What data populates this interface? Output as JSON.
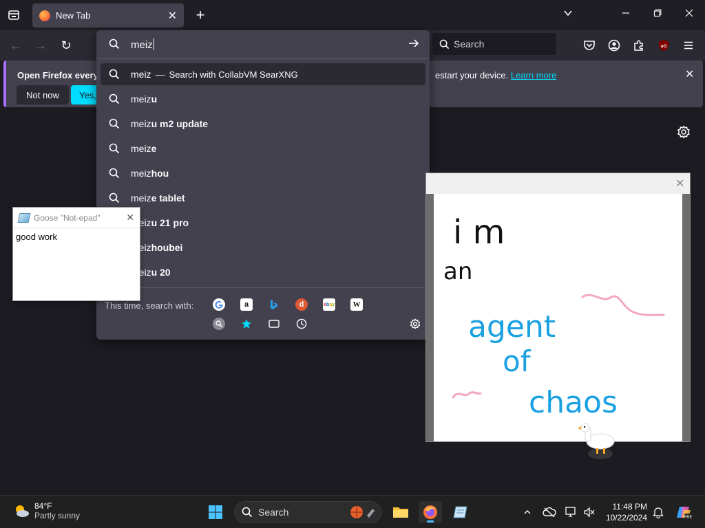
{
  "browser": {
    "tab": {
      "title": "New Tab",
      "close": "✕"
    },
    "new_tab": "+",
    "window_controls": {
      "list": "⌄",
      "minimize": "—",
      "maximize": "❐",
      "close": "✕"
    },
    "nav": {
      "back": "←",
      "forward": "→",
      "reload": "↻"
    },
    "search_placeholder": "Search"
  },
  "notification": {
    "message_start": "Open Firefox every ti",
    "message_end": "estart your device.",
    "learn_more": "Learn more",
    "not_now": "Not now",
    "yes": "Yes, o",
    "close": "✕"
  },
  "urlbar": {
    "value": "meiz",
    "suggestions": [
      {
        "typed": "meiz",
        "rest": "",
        "sep": "—",
        "action": "Search with CollabVM SearXNG",
        "selected": true
      },
      {
        "typed": "meiz",
        "rest": "u"
      },
      {
        "typed": "meiz",
        "rest": "u m2 update"
      },
      {
        "typed": "meiz",
        "rest": "e"
      },
      {
        "typed": "meiz",
        "rest": "hou"
      },
      {
        "typed": "meiz",
        "rest": "e tablet"
      },
      {
        "typed": "meiz",
        "rest": "u 21 pro"
      },
      {
        "typed": "meiz",
        "rest": "houbei"
      },
      {
        "typed": "meiz",
        "rest": "u 20"
      }
    ],
    "oneoff_label": "This time, search with:",
    "engines": [
      "google-icon",
      "amazon-icon",
      "bing-icon",
      "duckduckgo-icon",
      "ebay-icon",
      "wikipedia-icon",
      "searxng-icon",
      "bookmarks-icon",
      "tabs-icon",
      "history-icon"
    ]
  },
  "notepad": {
    "title": "Goose \"Not-epad\"",
    "body": "good work",
    "close": "✕"
  },
  "drawing": {
    "close": "✕",
    "lines": [
      "i m",
      "an",
      "agent",
      "of",
      "chaos"
    ]
  },
  "taskbar": {
    "weather_temp": "84°F",
    "weather_desc": "Partly sunny",
    "search_placeholder": "Search",
    "time": "11:48 PM",
    "date": "10/22/2024",
    "tray_chevron": "^"
  },
  "colors": {
    "accent": "#00ddff",
    "ink_black": "#111111",
    "ink_blue": "#1ba1e2",
    "ink_pink": "#f4a6c0"
  }
}
